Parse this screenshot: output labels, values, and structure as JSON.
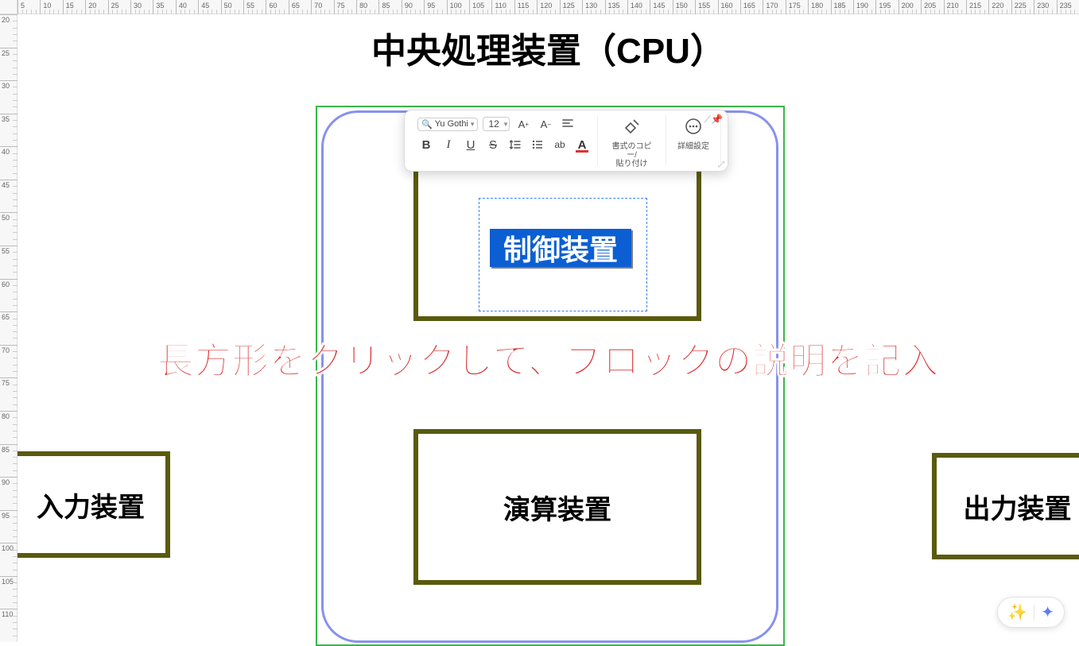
{
  "ruler": {
    "h_start": 5,
    "h_end": 235,
    "h_step": 5,
    "v_start": 20,
    "v_end": 110,
    "v_step": 5
  },
  "title": "中央処理装置（CPU）",
  "blocks": {
    "control": "制御装置",
    "arithmetic": "演算装置",
    "input": "入力装置",
    "output": "出力装置"
  },
  "instruction": "長方形をクリックして、ブロックの説明を記入",
  "toolbar": {
    "font": "Yu Gothi",
    "size": "12",
    "increase_font": "A+",
    "decrease_font": "A-",
    "align_icon": "align",
    "bold": "B",
    "italic": "I",
    "underline": "U",
    "strike": "S",
    "line_spacing": "line-spacing",
    "bullets": "bullets",
    "superscript": "ab",
    "font_color": "A",
    "format_paint_label": "書式のコピー/\n貼り付け",
    "more_label": "詳細設定"
  }
}
